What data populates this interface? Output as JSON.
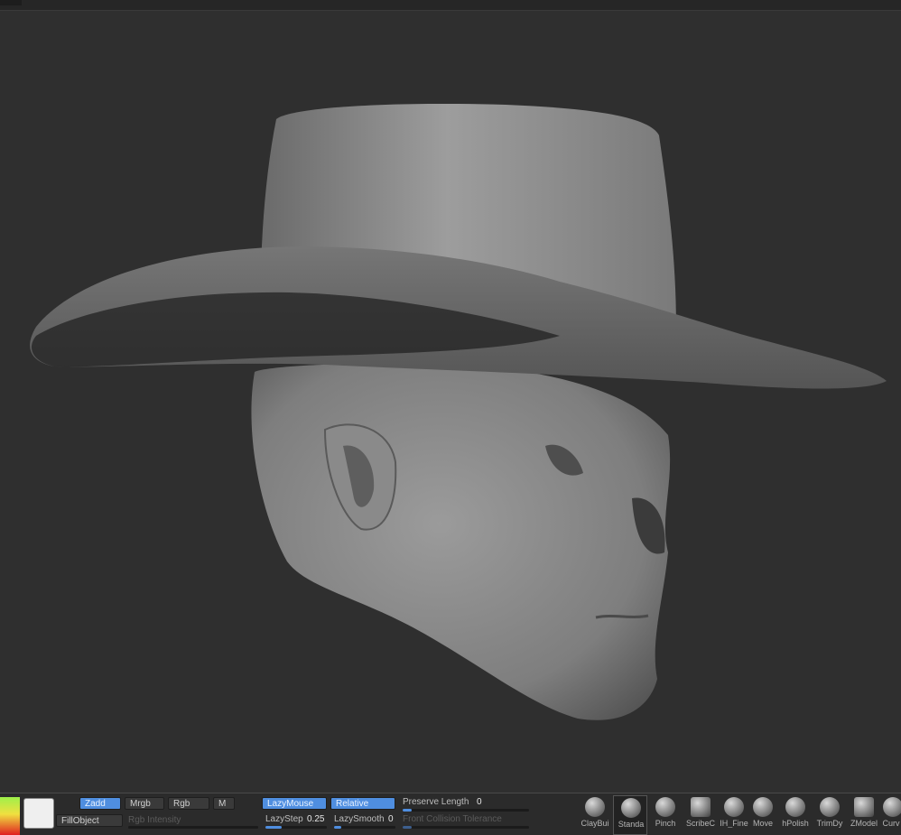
{
  "toolbar": {
    "zadd": "Zadd",
    "mrgb": "Mrgb",
    "rgb": "Rgb",
    "m": "M",
    "fill_object": "FillObject",
    "rgb_intensity": "Rgb Intensity",
    "lazy_mouse": "LazyMouse",
    "relative": "Relative",
    "lazy_step_label": "LazyStep",
    "lazy_step_value": "0.25",
    "lazy_smooth_label": "LazySmooth",
    "lazy_smooth_value": "0",
    "preserve_length_label": "Preserve Length",
    "preserve_length_value": "0",
    "front_collision_label": "Front Collision Tolerance"
  },
  "brushes": [
    {
      "label": "ClayBui",
      "icon": "clay-buildup-brush-icon"
    },
    {
      "label": "Standa",
      "icon": "standard-brush-icon"
    },
    {
      "label": "Pinch",
      "icon": "pinch-brush-icon"
    },
    {
      "label": "ScribeC",
      "icon": "scribe-curve-brush-icon"
    },
    {
      "label": "IH_Fine",
      "icon": "fine-brush-icon"
    },
    {
      "label": "Move",
      "icon": "move-brush-icon"
    },
    {
      "label": "hPolish",
      "icon": "hpolish-brush-icon"
    },
    {
      "label": "TrimDy",
      "icon": "trim-dynamic-brush-icon"
    },
    {
      "label": "ZModel",
      "icon": "zmodeler-brush-icon"
    },
    {
      "label": "Curv",
      "icon": "curve-brush-icon"
    }
  ],
  "colors": {
    "accent": "#4f8ee0",
    "background": "#2f2f2f",
    "secondary_color": "#efefef"
  }
}
